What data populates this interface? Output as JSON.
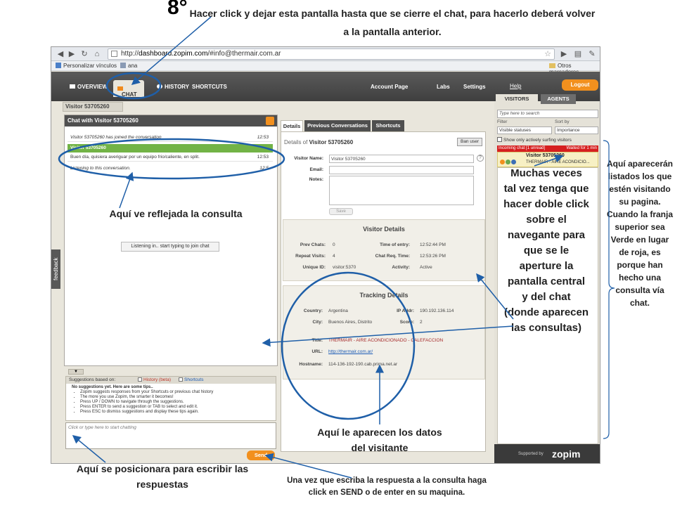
{
  "annotations": {
    "step_number": "8°",
    "step_text": "Hacer click y dejar esta pantalla hasta que se cierre el chat, para hacerlo deberá volver a la pantalla anterior.",
    "consulta": "Aquí ve reflejada la consulta",
    "doble_click": "Muchas veces tal vez tenga que hacer doble click sobre el navegante para que se le aperture la pantalla central y del chat (donde aparecen las consultas)",
    "right_note": "Aquí aparecerán listados los que estén visitando su pagina. Cuando la franja superior sea Verde en lugar de roja, es porque han hecho una consulta vía chat.",
    "datos_visitante": "Aquí le aparecen los datos del visitante",
    "escribir": "Aquí se posicionara para escribir las respuestas",
    "send_note": "Una vez que escriba la respuesta a la consulta haga click en SEND o de enter en su maquina."
  },
  "browser": {
    "url_prefix": "http://",
    "url_host": "dashboard.zopim.com",
    "url_rest": "/#info@thermair.com.ar",
    "bookmarks": [
      "Personalizar vínculos",
      "ana"
    ],
    "other_bookmarks": "Otros marcadores"
  },
  "nav": {
    "overview": "OVERVIEW",
    "chat": "CHAT",
    "history": "HISTORY",
    "shortcuts": "SHORTCUTS",
    "account": "Account Page",
    "labs": "Labs",
    "settings": "Settings",
    "help": "Help",
    "logout": "Logout"
  },
  "sidebar": {
    "tab_visitors": "VISITORS",
    "tab_agents": "AGENTS",
    "search_placeholder": "Type here to search",
    "filter_label": "Filter",
    "sort_label": "Sort by",
    "filter_value": "Visible statuses",
    "sort_value": "Importance",
    "only_active": "Show only actively surfing visitors",
    "incoming": "Incoming chat [1 unread]",
    "waited": "Waited for 1 min",
    "visitor_name": "Visitor 53705260",
    "visitor_sub": "THERMAIR - AIRE ACONDICIO...",
    "supported_by": "Supported by",
    "brand": "zopim"
  },
  "chat": {
    "visitor_tab": "Visitor 53705260",
    "header": "Chat with Visitor 53705260",
    "messages": [
      {
        "text": "Visitor 53705260 has joined the conversation",
        "time": "12:53"
      },
      {
        "text": "Visitor 53705260",
        "time": ""
      },
      {
        "text": "Buen día, quisiera averiguar por un equipo frio/caliente, en split.",
        "time": "12:53"
      },
      {
        "text": "Listening to this conversation.",
        "time": "12:5"
      }
    ],
    "listening_button": "Listening in.. start typing to join chat",
    "feedback": "feedback",
    "suggestions_label": "Suggestions based on:",
    "history_beta": "History (beta)",
    "shortcuts": "Shortcuts",
    "sugg_head": "No suggestions yet. Here are some tips..",
    "tips": [
      "Zopim suggests responses from your Shortcuts or previous chat history",
      "The more you use Zopim, the smarter it becomes!",
      "Press UP / DOWN to navigate through the suggestions.",
      "Press ENTER to send a suggestion or TAB to select and edit it.",
      "Press ESC to dismiss suggestions and display these tips again."
    ],
    "input_placeholder": "Click or type here to start chatting",
    "send": "Send"
  },
  "details": {
    "tabs": [
      "Details",
      "Previous Conversations",
      "Shortcuts"
    ],
    "title_prefix": "Details of",
    "title_name": "Visitor 53705260",
    "ban_user": "Ban user",
    "name_label": "Visitor Name:",
    "name_value": "Visitor 53705260",
    "email_label": "Email:",
    "notes_label": "Notes:",
    "save": "Save",
    "visitor_details_title": "Visitor Details",
    "prev_chats_label": "Prev Chats:",
    "prev_chats": "0",
    "repeat_visits_label": "Repeat Visits:",
    "repeat_visits": "4",
    "unique_id_label": "Unique ID:",
    "unique_id": "visitor:5370",
    "time_entry_label": "Time of entry:",
    "time_entry": "12:52:44 PM",
    "chat_req_label": "Chat Req. Time:",
    "chat_req": "12:53:26 PM",
    "activity_label": "Activity:",
    "activity": "Active",
    "tracking_title": "Tracking Details",
    "country_label": "Country:",
    "country": "Argentina",
    "city_label": "City:",
    "city": "Buenos Aires, Distrito",
    "ip_label": "IP Addr:",
    "ip": "190.192.136.114",
    "score_label": "Score:",
    "score": "2",
    "title_label": "Title:",
    "title_value": "THERMAIR - AIRE ACONDICIONADO - CALEFACCION",
    "url_label": "URL:",
    "url_value": "http://thermair.com.ar/",
    "hostname_label": "Hostname:",
    "hostname": "114-136-192-190.cab.prima.net.ar"
  },
  "colors": {
    "accent_orange": "#f2901e",
    "annotation_blue": "#1f5fa8",
    "incoming_red": "#d61f1f",
    "message_green": "#72b346"
  }
}
